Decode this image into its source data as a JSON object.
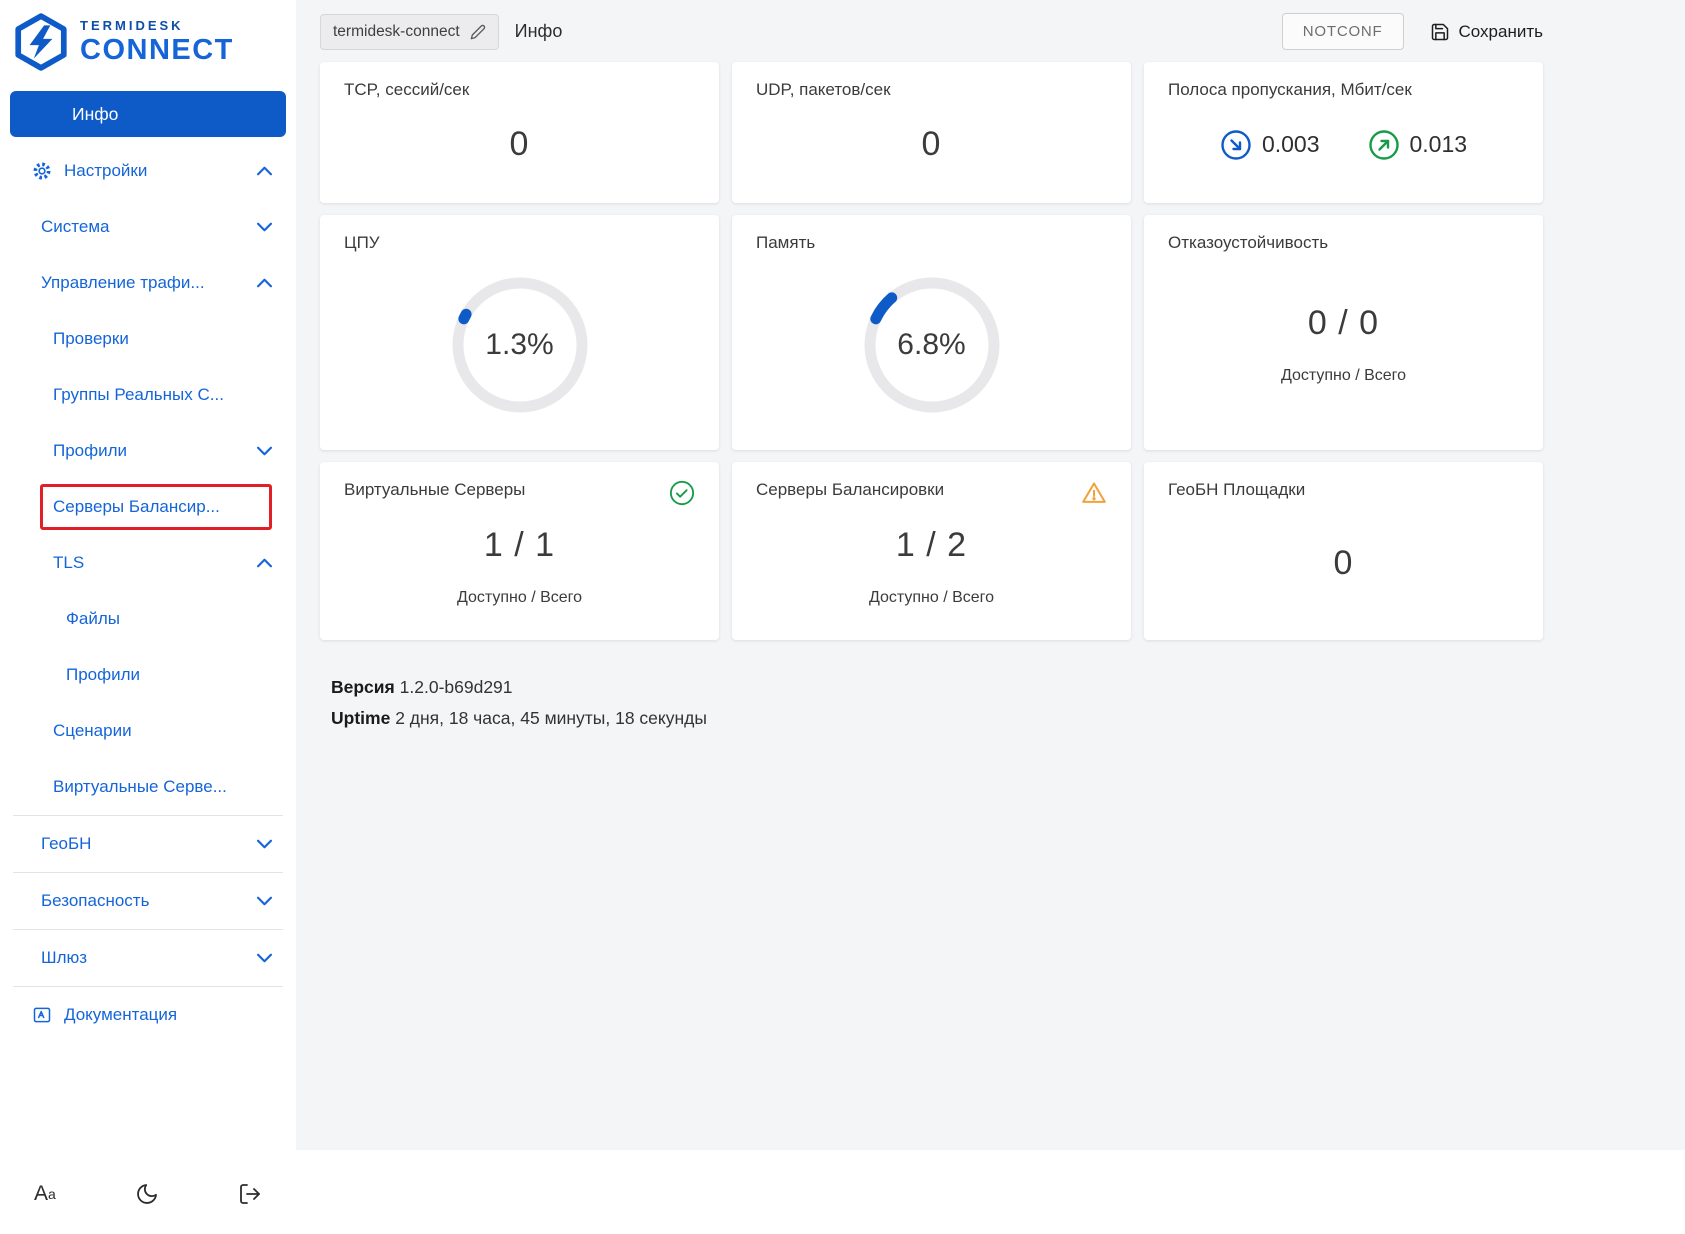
{
  "colors": {
    "accent_blue": "#0e5bc8",
    "link_blue": "#1565d8",
    "ok_green": "#189a4a",
    "warning_orange": "#f0a23c",
    "highlight_red": "#e01f26",
    "main_bg": "#f4f5f7"
  },
  "brand": {
    "name_top": "TERMIDESK",
    "name_bottom": "CONNECT"
  },
  "sidebar": {
    "items": [
      {
        "label": "Инфо",
        "active": true
      },
      {
        "label": "Настройки",
        "icon": "gear-icon",
        "expanded": true
      },
      {
        "label": "Система",
        "expanded": false
      },
      {
        "label": "Управление трафи...",
        "expanded": true
      },
      {
        "label": "Проверки"
      },
      {
        "label": "Группы Реальных С..."
      },
      {
        "label": "Профили",
        "expanded": false
      },
      {
        "label": "Серверы Балансир...",
        "highlighted": true
      },
      {
        "label": "TLS",
        "expanded": true
      },
      {
        "label": "Файлы"
      },
      {
        "label": "Профили"
      },
      {
        "label": "Сценарии"
      },
      {
        "label": "Виртуальные Серве..."
      },
      {
        "label": "ГеоБН",
        "expanded": false
      },
      {
        "label": "Безопасность",
        "expanded": false
      },
      {
        "label": "Шлюз",
        "expanded": false
      },
      {
        "label": "Документация",
        "icon": "document-icon"
      }
    ]
  },
  "header": {
    "hostname": "termidesk-connect",
    "title": "Инфо",
    "notconf_label": "NOTCONF",
    "save_label": "Сохранить"
  },
  "cards": {
    "tcp": {
      "title": "TCP, сессий/сек",
      "value": "0"
    },
    "udp": {
      "title": "UDP, пакетов/сек",
      "value": "0"
    },
    "bandwidth": {
      "title": "Полоса пропускания, Мбит/сек",
      "inbound": "0.003",
      "outbound": "0.013"
    },
    "cpu": {
      "title": "ЦПУ",
      "value": "1.3%",
      "percent": 1.3
    },
    "memory": {
      "title": "Память",
      "value": "6.8%",
      "percent": 6.8
    },
    "failover": {
      "title": "Отказоустойчивость",
      "value": "0 / 0",
      "caption": "Доступно / Всего"
    },
    "virtual_servers": {
      "title": "Виртуальные Серверы",
      "value": "1 / 1",
      "caption": "Доступно / Всего",
      "status": "ok"
    },
    "balancers": {
      "title": "Серверы Балансировки",
      "value": "1 / 2",
      "caption": "Доступно / Всего",
      "status": "warning"
    },
    "geo_sites": {
      "title": "ГеоБН Площадки",
      "value": "0"
    }
  },
  "meta": {
    "version_label": "Версия",
    "version_value": "1.2.0-b69d291",
    "uptime_label": "Uptime",
    "uptime_value": "2 дня, 18 часа, 45 минуты, 18 секунды"
  }
}
